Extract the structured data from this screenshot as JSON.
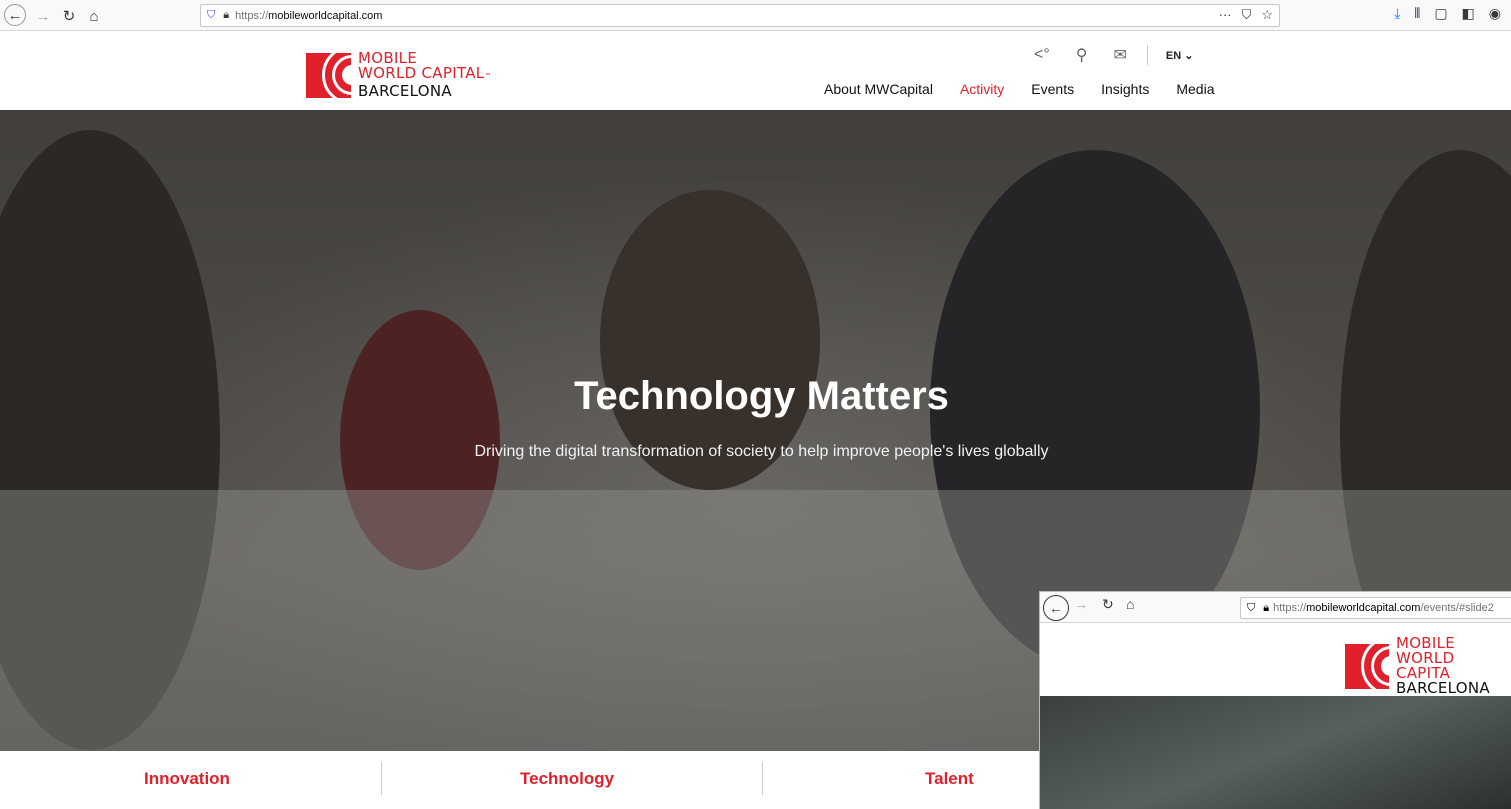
{
  "browser": {
    "url_proto": "https://",
    "url_host": "mobileworldcapital.com",
    "icons": [
      "back-icon",
      "forward-icon",
      "reload-icon",
      "home-icon",
      "shield-icon",
      "lock-icon",
      "more-icon",
      "pocket-icon",
      "bookmark-star-icon",
      "download-icon",
      "library-icon",
      "sidebar-icon",
      "extension-icon",
      "account-icon"
    ]
  },
  "header": {
    "logo": {
      "line1": "MOBILE",
      "line2": "WORLD CAPITAL",
      "tm": "™",
      "line3": "BARCELONA"
    },
    "lang": "EN ⌄",
    "nav": [
      {
        "label": "About MWCapital",
        "active": false
      },
      {
        "label": "Activity",
        "active": true
      },
      {
        "label": "Events",
        "active": false
      },
      {
        "label": "Insights",
        "active": false
      },
      {
        "label": "Media",
        "active": false
      }
    ],
    "accent": "#e0202b"
  },
  "hero": {
    "title": "Technology Matters",
    "subtitle": "Driving the digital transformation of society to help improve people's lives globally"
  },
  "pillars": [
    "Innovation",
    "Technology",
    "Talent"
  ],
  "popup": {
    "url_proto": "https://",
    "url_host": "mobileworldcapital.com",
    "url_path": "/events/#slide2",
    "logo": {
      "line1": "MOBILE",
      "line2": "WORLD CAPITA",
      "line3": "BARCELONA"
    }
  }
}
